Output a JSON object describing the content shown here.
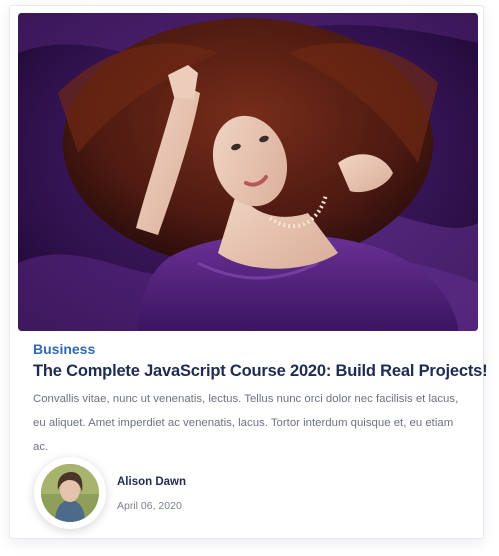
{
  "post": {
    "category": "Business",
    "title": "The Complete JavaScript Course 2020: Build Real Projects!",
    "excerpt": "Convallis vitae, nunc ut venenatis, lectus. Tellus nunc orci dolor nec facilisis et lacus, eu aliquet. Amet imperdiet ac venenatis, lacus. Tortor interdum quisque et, eu etiam ac.",
    "image_icon": "woman-in-purple-fabric-photo"
  },
  "author": {
    "name": "Alison Dawn",
    "date": "April 06, 2020",
    "avatar_icon": "author-avatar-photo"
  },
  "colors": {
    "category": "#2d6bb3",
    "title": "#1f2c52",
    "excerpt": "#6c7281",
    "photo_bg": "#2a0e42"
  }
}
